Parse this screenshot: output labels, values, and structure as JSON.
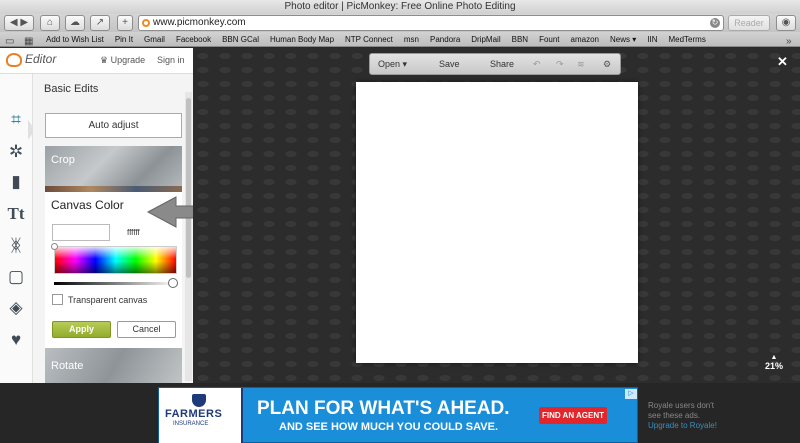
{
  "browser": {
    "window_title": "Photo editor | PicMonkey: Free Online Photo Editing",
    "url": "www.picmonkey.com",
    "reader_label": "Reader",
    "bookmarks": [
      "Add to Wish List",
      "Pin It",
      "Gmail",
      "Facebook",
      "BBN GCal",
      "Human Body Map",
      "NTP Connect",
      "msn",
      "Pandora",
      "DripMail",
      "BBN",
      "Fount",
      "amazon",
      "News ▾",
      "IIN",
      "MedTerms"
    ]
  },
  "app_header": {
    "logo_text": "Editor",
    "upgrade_label": "Upgrade",
    "signin_label": "Sign in"
  },
  "rail": {
    "icons": [
      "crop-icon",
      "magic-wand-icon",
      "brush-icon",
      "text-icon",
      "butterfly-icon",
      "frame-icon",
      "texture-icon",
      "heart-icon"
    ]
  },
  "panel": {
    "title": "Basic Edits",
    "auto_adjust_label": "Auto adjust",
    "crop_label": "Crop",
    "canvas_color": {
      "title": "Canvas Color",
      "hex_value": "ffffff",
      "transparent_label": "Transparent canvas",
      "apply_label": "Apply",
      "cancel_label": "Cancel"
    },
    "rotate_label": "Rotate"
  },
  "workspace": {
    "toolbar": {
      "open_label": "Open",
      "save_label": "Save",
      "share_label": "Share"
    },
    "zoom_label": "21%"
  },
  "ad": {
    "brand": "FARMERS",
    "brand_sub": "INSURANCE",
    "headline": "PLAN FOR WHAT'S AHEAD.",
    "subline": "AND SEE HOW MUCH YOU COULD SAVE.",
    "button_label": "FIND AN AGENT",
    "royale_note": "Royale users don't see these ads.",
    "royale_link": "Upgrade to Royale!"
  },
  "colors": {
    "accent": "#2d84a8",
    "apply_green": "#9ab232",
    "ad_blue": "#1a8ed8",
    "ad_red": "#e3262b"
  }
}
